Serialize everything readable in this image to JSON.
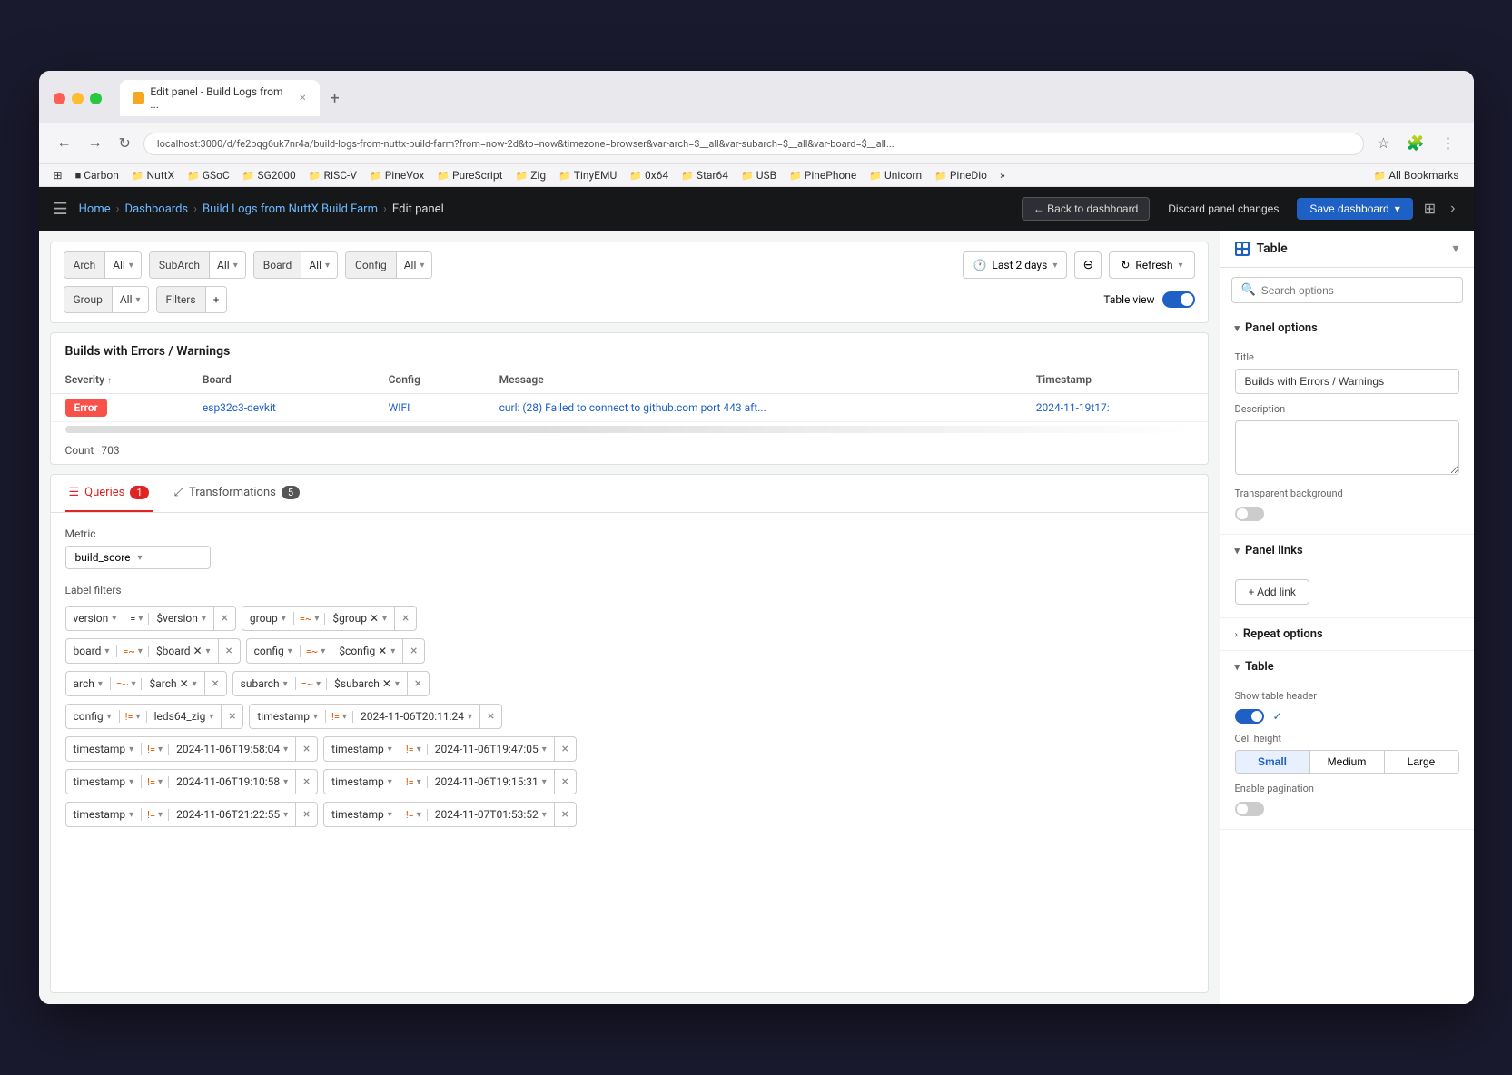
{
  "browser": {
    "tab_label": "Edit panel - Build Logs from ...",
    "url": "localhost:3000/d/fe2bqg6uk7nr4a/build-logs-from-nuttx-build-farm?from=now-2d&to=now&timezone=browser&var-arch=$__all&var-subarch=$__all&var-board=$__all...",
    "bookmarks": [
      "Carbon",
      "NuttX",
      "GSoC",
      "SG2000",
      "RISC-V",
      "PineVox",
      "PureScript",
      "Zig",
      "TinyEMU",
      "0x64",
      "Star64",
      "USB",
      "PinePhone",
      "Unicorn",
      "PineDio"
    ],
    "all_bookmarks": "All Bookmarks"
  },
  "topnav": {
    "breadcrumb": {
      "home": "Home",
      "dashboards": "Dashboards",
      "build_logs": "Build Logs from NuttX Build Farm",
      "current": "Edit panel"
    },
    "back_button": "← Back to dashboard",
    "discard_button": "Discard panel changes",
    "save_button": "Save dashboard",
    "save_chevron": "▾"
  },
  "filters": {
    "arch_label": "Arch",
    "arch_value": "All",
    "subarch_label": "SubArch",
    "subarch_value": "All",
    "board_label": "Board",
    "board_value": "All",
    "config_label": "Config",
    "config_value": "All",
    "time_label": "Last 2 days",
    "zoom_icon": "⊖",
    "refresh_label": "Refresh",
    "group_label": "Group",
    "group_value": "All",
    "filters_label": "Filters",
    "filters_plus": "+",
    "table_view_label": "Table view"
  },
  "data_table": {
    "title": "Builds with Errors / Warnings",
    "columns": [
      "Severity",
      "Board",
      "Config",
      "Message",
      "Timestamp"
    ],
    "sort_col": "Severity",
    "rows": [
      {
        "severity": "Error",
        "board": "esp32c3-devkit",
        "config": "WIFI",
        "message": "curl: (28) Failed to connect to github.com port 443 aft...",
        "timestamp": "2024-11-19t17:"
      }
    ],
    "count_label": "Count",
    "count_value": "703"
  },
  "queries": {
    "tab_label": "Queries",
    "tab_badge": "1",
    "transformations_label": "Transformations",
    "transformations_badge": "5",
    "metric_label": "Metric",
    "metric_value": "build_score",
    "label_filters_title": "Label filters",
    "filters": [
      {
        "name": "version",
        "op": "=",
        "op_type": "eq",
        "value": "$version",
        "has_x": true
      },
      {
        "name": "group",
        "op": "=~",
        "op_type": "neq",
        "value": "$group",
        "has_x": true
      },
      {
        "name": "board",
        "op": "=~",
        "op_type": "neq",
        "value": "$board",
        "has_x": true
      },
      {
        "name": "config",
        "op": "=~",
        "op_type": "neq",
        "value": "$config",
        "has_x": true
      },
      {
        "name": "arch",
        "op": "=~",
        "op_type": "neq",
        "value": "$arch",
        "has_x": true
      },
      {
        "name": "subarch",
        "op": "=~",
        "op_type": "neq",
        "value": "$subarch",
        "has_x": true
      },
      {
        "name": "config",
        "op": "!=",
        "op_type": "neq",
        "value": "leds64_zig",
        "has_x": true
      },
      {
        "name": "timestamp",
        "op": "!=",
        "op_type": "neq",
        "value": "2024-11-06T20:11:24",
        "has_x": true
      },
      {
        "name": "timestamp",
        "op": "!=",
        "op_type": "neq",
        "value": "2024-11-06T19:58:04",
        "has_x": true
      },
      {
        "name": "timestamp",
        "op": "!=",
        "op_type": "neq",
        "value": "2024-11-06T19:47:05",
        "has_x": true
      },
      {
        "name": "timestamp",
        "op": "!=",
        "op_type": "neq",
        "value": "2024-11-06T19:10:58",
        "has_x": true
      },
      {
        "name": "timestamp",
        "op": "!=",
        "op_type": "neq",
        "value": "2024-11-06T19:15:31",
        "has_x": true
      },
      {
        "name": "timestamp",
        "op": "!=",
        "op_type": "neq",
        "value": "2024-11-06T21:22:55",
        "has_x": true
      },
      {
        "name": "timestamp",
        "op": "!=",
        "op_type": "neq",
        "value": "2024-11-07T01:53:52",
        "has_x": true
      }
    ]
  },
  "right_panel": {
    "title": "Table",
    "search_placeholder": "Search options",
    "panel_options": {
      "section_label": "Panel options",
      "title_label": "Title",
      "title_value": "Builds with Errors / Warnings",
      "description_label": "Description",
      "description_value": "",
      "transparent_bg_label": "Transparent background",
      "transparent_bg_on": false
    },
    "panel_links": {
      "section_label": "Panel links",
      "add_link_label": "+ Add link"
    },
    "repeat_options": {
      "section_label": "Repeat options",
      "collapsed": true
    },
    "table_section": {
      "section_label": "Table",
      "show_header_label": "Show table header",
      "show_header_on": true,
      "cell_height_label": "Cell height",
      "cell_heights": [
        "Small",
        "Medium",
        "Large"
      ],
      "cell_height_active": "Small",
      "enable_pagination_label": "Enable pagination",
      "enable_pagination_on": false
    }
  }
}
